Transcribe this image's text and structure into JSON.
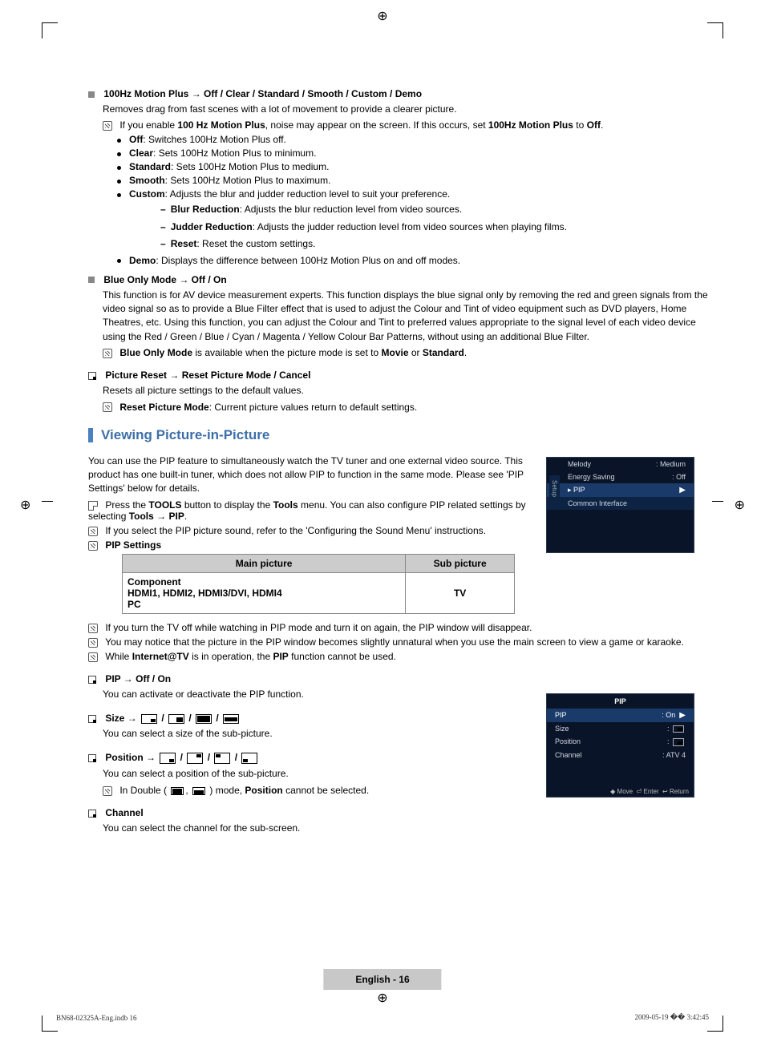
{
  "section_motion": {
    "title_pre": "100Hz Motion Plus → ",
    "title_opts": "Off / Clear / Standard / Smooth / Custom / Demo",
    "desc": "Removes drag from fast scenes with a lot of movement to provide a clearer picture.",
    "note_pre": "If you enable ",
    "note_b1": "100 Hz Motion Plus",
    "note_mid": ", noise may appear on the screen. If this occurs, set ",
    "note_b2": "100Hz Motion Plus",
    "note_to": " to ",
    "note_b3": "Off",
    "note_end": ".",
    "off_b": "Off",
    "off_t": ": Switches 100Hz Motion Plus off.",
    "clear_b": "Clear",
    "clear_t": ": Sets 100Hz Motion Plus to minimum.",
    "std_b": "Standard",
    "std_t": ": Sets 100Hz Motion Plus to medium.",
    "smooth_b": "Smooth",
    "smooth_t": ": Sets 100Hz Motion Plus to maximum.",
    "custom_b": "Custom",
    "custom_t": ": Adjusts the blur and judder reduction level to suit your preference.",
    "blur_b": "Blur Reduction",
    "blur_t": ": Adjusts the blur reduction level from video sources.",
    "judder_b": "Judder Reduction",
    "judder_t": ": Adjusts the judder reduction level from video sources when playing films.",
    "reset_b": "Reset",
    "reset_t": ": Reset the custom settings.",
    "demo_b": "Demo",
    "demo_t": ": Displays the difference between 100Hz Motion Plus on and off modes."
  },
  "section_blue": {
    "title": "Blue Only Mode → Off / On",
    "desc": "This function is for AV device measurement experts. This function displays the blue signal only by removing the red and green signals from the video signal so as to provide a Blue Filter effect that is used to adjust the Colour and Tint of video equipment such as DVD players, Home Theatres, etc. Using this function, you can adjust the Colour and Tint to preferred values appropriate to the signal level of each video device using the Red / Green / Blue / Cyan / Magenta / Yellow Colour Bar Patterns, without using an additional Blue Filter.",
    "note_b": "Blue Only Mode",
    "note_t": " is available when the picture mode is set to ",
    "note_b2": "Movie",
    "note_or": " or ",
    "note_b3": "Standard",
    "note_end": "."
  },
  "section_reset": {
    "title": "Picture Reset → Reset Picture Mode / Cancel",
    "desc": "Resets all picture settings to the default values.",
    "note_b": "Reset Picture Mode",
    "note_t": ": Current picture values return to default settings."
  },
  "section_pip_hdr": "Viewing Picture-in-Picture",
  "pip_intro": "You can use the PIP feature to simultaneously watch the TV tuner and one external video source. This product has one built-in tuner, which does not allow PIP to function in the same mode. Please see 'PIP Settings' below for details.",
  "pip_tools_pre": "Press the ",
  "pip_tools_b1": "TOOLS",
  "pip_tools_mid": " button to display the ",
  "pip_tools_b2": "Tools",
  "pip_tools_mid2": " menu. You can also configure PIP related settings by selecting ",
  "pip_tools_b3": "Tools → PIP",
  "pip_tools_end": ".",
  "pip_sound": "If you select the PIP picture sound, refer to the 'Configuring the Sound Menu' instructions.",
  "pip_settings_hdr": "PIP Settings",
  "pip_table": {
    "h_main": "Main picture",
    "h_sub": "Sub picture",
    "main1": "Component",
    "main2": "HDMI1, HDMI2, HDMI3/DVI, HDMI4",
    "main3": "PC",
    "sub": "TV"
  },
  "pip_note1": "If you turn the TV off while watching in PIP mode and turn it on again, the PIP window will disappear.",
  "pip_note2": "You may notice that the picture in the PIP window becomes slightly unnatural when you use the main screen to view a game or karaoke.",
  "pip_note3_pre": "While ",
  "pip_note3_b": "Internet@TV",
  "pip_note3_mid": " is in operation, the ",
  "pip_note3_b2": "PIP",
  "pip_note3_end": " function cannot be used.",
  "pip_onoff": {
    "title": "PIP → Off / On",
    "desc": "You can activate or deactivate the PIP function."
  },
  "size": {
    "title_pre": "Size → ",
    "desc": "You can select a size of the sub-picture."
  },
  "position": {
    "title_pre": "Position → ",
    "desc": "You can select a position of the sub-picture.",
    "note_pre": "In Double (",
    "note_mid": ") mode, ",
    "note_b": "Position",
    "note_end": " cannot be selected."
  },
  "channel": {
    "title": "Channel",
    "desc": "You can select the channel for the sub-screen."
  },
  "osd1": {
    "melody_l": "Melody",
    "melody_v": ": Medium",
    "es_l": "Energy Saving",
    "es_v": ": Off",
    "pip_l": "PIP",
    "ci_l": "Common Interface",
    "tab": "Setup"
  },
  "osd2": {
    "title": "PIP",
    "pip_l": "PIP",
    "pip_v": ": On",
    "size_l": "Size",
    "size_v": ": ",
    "pos_l": "Position",
    "pos_v": ": ",
    "ch_l": "Channel",
    "ch_v": ": ATV 4",
    "foot_move": "Move",
    "foot_enter": "Enter",
    "foot_return": "Return"
  },
  "page_badge": "English - 16",
  "footer_left": "BN68-02325A-Eng.indb   16",
  "footer_right": "2009-05-19   �� 3:42:45"
}
